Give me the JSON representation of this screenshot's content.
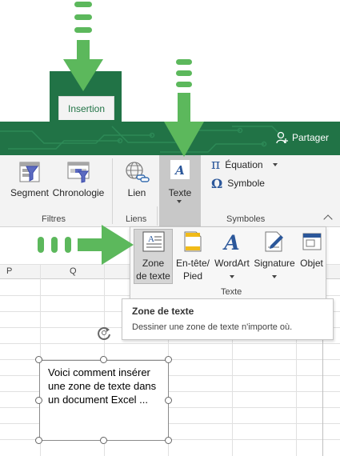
{
  "tab": {
    "active": "Insertion"
  },
  "header": {
    "share_label": "Partager"
  },
  "ribbon": {
    "buttons": {
      "segment": "Segment",
      "chronologie": "Chronologie",
      "lien": "Lien",
      "texte": "Texte",
      "equation": "Équation",
      "symbole": "Symbole"
    },
    "groups": {
      "filtres": "Filtres",
      "liens": "Liens",
      "symboles": "Symboles"
    },
    "equation_glyph": "π",
    "symbole_glyph": "Ω"
  },
  "sheet": {
    "columns": [
      "P",
      "Q"
    ]
  },
  "texte_menu": {
    "items": [
      {
        "line1": "Zone",
        "line2": "de texte"
      },
      {
        "line1": "En-tête/",
        "line2": "Pied"
      },
      {
        "line1": "WordArt",
        "line2": ""
      },
      {
        "line1": "Signature",
        "line2": ""
      },
      {
        "line1": "Objet",
        "line2": ""
      }
    ],
    "group_label": "Texte"
  },
  "tooltip": {
    "title": "Zone de texte",
    "description": "Dessiner une zone de texte n'importe où."
  },
  "textbox": {
    "line1": "Voici comment insérer",
    "line2": "une zone de texte dans",
    "line3": "un document Excel ..."
  },
  "colors": {
    "excel_green": "#217346",
    "arrow_green": "#5cb85c",
    "ribbon_bg": "#f3f3f3",
    "accent_blue": "#2b579a"
  }
}
